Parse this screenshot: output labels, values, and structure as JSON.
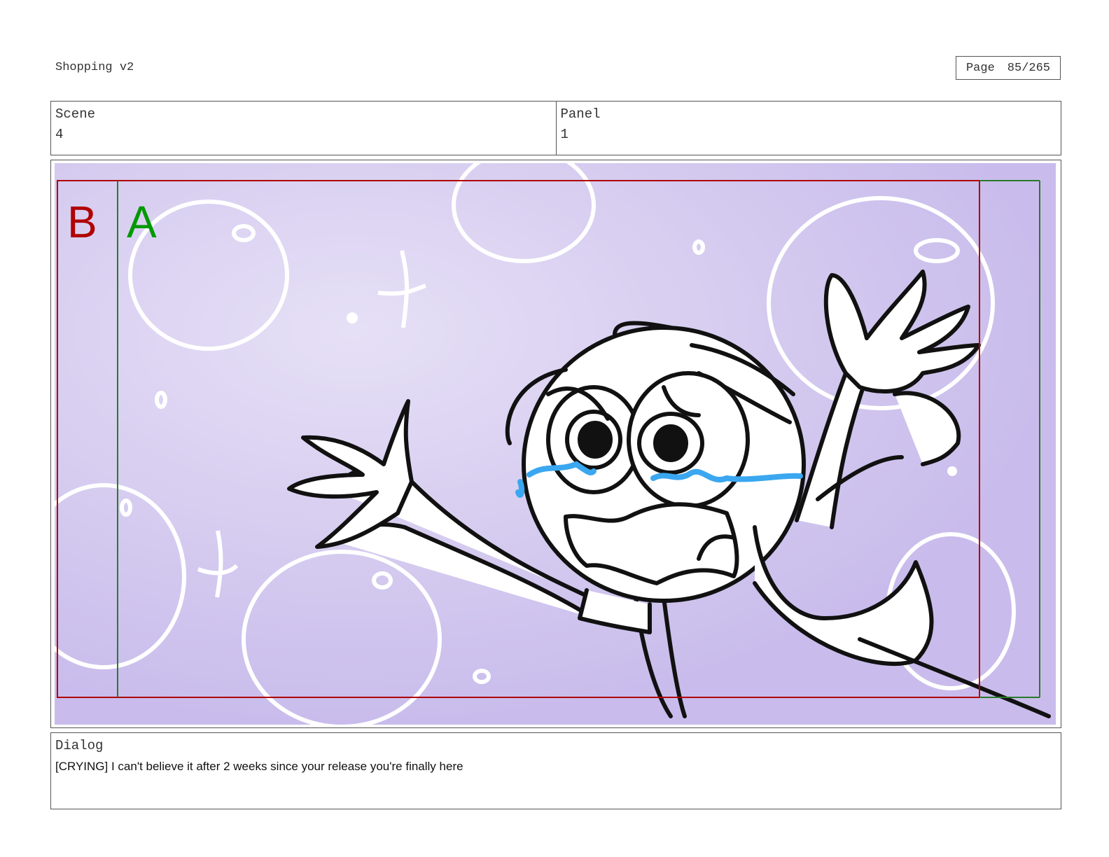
{
  "document": {
    "title": "Shopping v2",
    "page_label": "Page",
    "page_number": "85/265"
  },
  "info": {
    "scene_label": "Scene",
    "scene_value": "4",
    "panel_label": "Panel",
    "panel_value": "1"
  },
  "safe_frames": {
    "frame_b_label": "B",
    "frame_a_label": "A",
    "frame_b_color": "#b00000",
    "frame_a_color": "#009900"
  },
  "artwork": {
    "background_color": "#cdc3ee",
    "tear_color": "#3aa7f0"
  },
  "dialog": {
    "label": "Dialog",
    "text": "[CRYING] I can't believe it after 2 weeks since your release you're finally here"
  }
}
